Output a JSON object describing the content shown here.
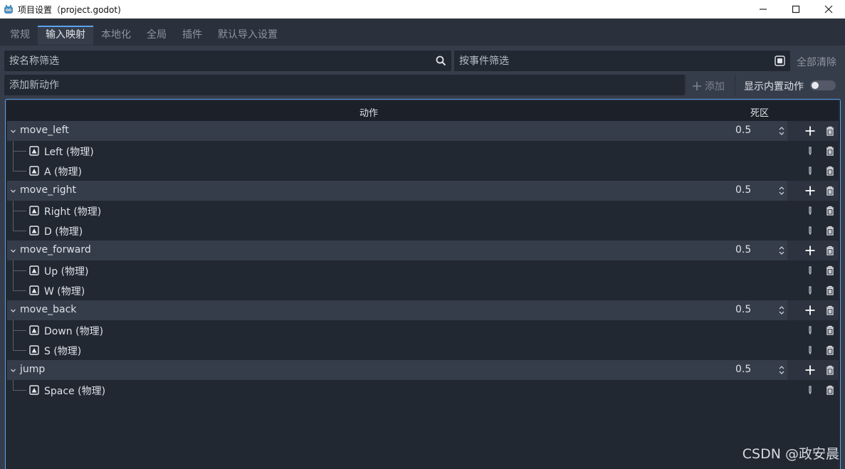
{
  "window": {
    "title": "项目设置（project.godot)",
    "icon": "godot-icon"
  },
  "tabs": [
    "常规",
    "输入映射",
    "本地化",
    "全局",
    "插件",
    "默认导入设置"
  ],
  "active_tab": 1,
  "filter": {
    "name_placeholder": "按名称筛选",
    "event_placeholder": "按事件筛选",
    "clear_all": "全部清除"
  },
  "add_action": {
    "placeholder": "添加新动作",
    "add_label": "添加",
    "show_builtin": "显示内置动作",
    "show_builtin_on": false
  },
  "tree": {
    "col_action": "动作",
    "col_deadzone": "死区",
    "actions": [
      {
        "name": "move_left",
        "deadzone": "0.5",
        "events": [
          "Left (物理)",
          "A (物理)"
        ]
      },
      {
        "name": "move_right",
        "deadzone": "0.5",
        "events": [
          "Right (物理)",
          "D (物理)"
        ]
      },
      {
        "name": "move_forward",
        "deadzone": "0.5",
        "events": [
          "Up (物理)",
          "W (物理)"
        ]
      },
      {
        "name": "move_back",
        "deadzone": "0.5",
        "events": [
          "Down (物理)",
          "S (物理)"
        ]
      },
      {
        "name": "jump",
        "deadzone": "0.5",
        "events": [
          "Space (物理)"
        ]
      }
    ]
  },
  "watermark": "CSDN @政安晨",
  "colors": {
    "accent": "#5aa4ee",
    "background": "#363d4a",
    "tree_bg": "#222832"
  }
}
